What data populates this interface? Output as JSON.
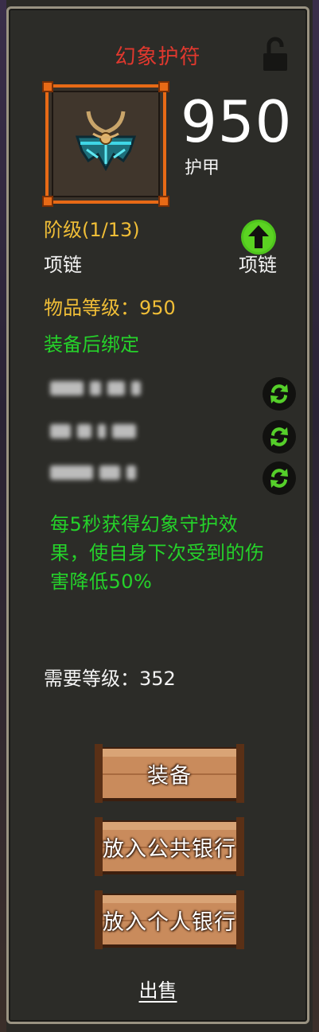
{
  "item": {
    "name": "幻象护符",
    "armor_value": "950",
    "armor_label": "护甲",
    "tier": "阶级(1/13)",
    "slot_left": "项链",
    "slot_right": "项链",
    "item_level": "物品等级：950",
    "bind": "装备后绑定",
    "description": "每5秒获得幻象守护效果，使自身下次受到的伤害降低50%",
    "required_level": "需要等级：352"
  },
  "buttons": {
    "equip": "装备",
    "public_bank": "放入公共银行",
    "personal_bank": "放入个人银行",
    "sell": "出售"
  },
  "icons": {
    "lock": "lock-icon",
    "upgrade": "upgrade-arrow-icon",
    "reroll": "reroll-icon",
    "item": "amulet-icon"
  },
  "colors": {
    "title": "#e0382e",
    "gold": "#f0be37",
    "effect": "#25d22a",
    "frame": "#e86a16"
  }
}
